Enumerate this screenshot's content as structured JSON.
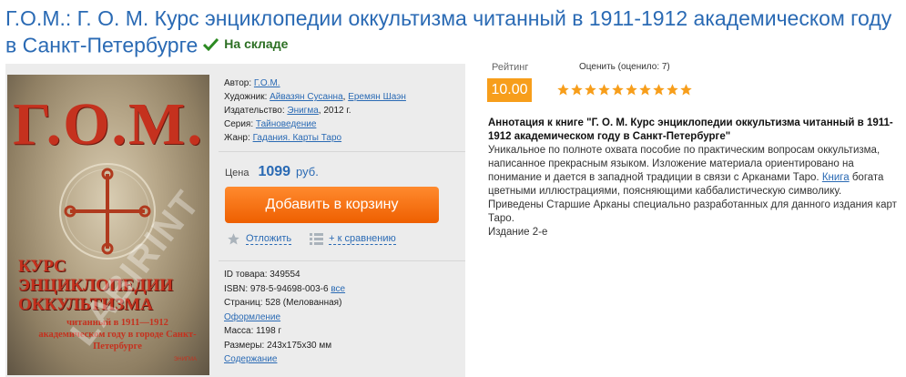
{
  "title": "Г.О.М.: Г. О. М. Курс энциклопедии оккультизма читанный в 1911-1912 академическом году в Санкт-Петербурге",
  "stock": {
    "label": "На складе",
    "color": "#2c6f23"
  },
  "cover": {
    "big": "Г.О.М.",
    "title": "КУРС ЭНЦИКЛОПЕДИИ ОККУЛЬТИЗМА",
    "subtitle": "читанный в 1911—1912 академическом году в городе Санкт-Петербурге",
    "publisher": "ЭНИГМА",
    "watermark": "LABIRINT"
  },
  "meta": {
    "author_label": "Автор:",
    "author": "Г.О.М.",
    "artist_label": "Художник:",
    "artist1": "Айвазян Сусанна",
    "artist2": "Еремян Шаэн",
    "publisher_label": "Издательство:",
    "publisher": "Энигма",
    "year": ", 2012 г.",
    "series_label": "Серия:",
    "series": "Тайноведение",
    "genre_label": "Жанр:",
    "genre": "Гадания. Карты Таро"
  },
  "price": {
    "label": "Цена",
    "value": "1099",
    "currency": "руб."
  },
  "cart_button": "Добавить в корзину",
  "actions": {
    "defer": "Отложить",
    "compare": "+ к сравнению"
  },
  "specs": {
    "id": "ID товара: 349554",
    "isbn": "ISBN: 978-5-94698-003-6",
    "isbn_all": "все",
    "pages": "Страниц: 528 (Мелованная)",
    "design": "Оформление",
    "weight": "Масса: 1198 г",
    "size": "Размеры: 243x175x30 мм",
    "contents": "Содержание"
  },
  "rating": {
    "label": "Рейтинг",
    "value": "10.00",
    "rate_label": "Оценить (оценило: 7)",
    "stars": 10,
    "accent": "#f79e1b"
  },
  "annotation": {
    "heading": "Аннотация к книге \"Г. О. М. Курс энциклопедии оккультизма читанный в 1911-1912 академическом году в Санкт-Петербурге\"",
    "p1": "Уникальное по полноте охвата пособие по практическим вопросам оккультизма, написанное прекрасным языком. Изложение материала ориентировано на понимание и дается в западной традиции в связи с Арканами Таро.",
    "link": "Книга",
    "p2": "богата цветными иллюстрациями, поясняющими каббалистическую символику. Приведены Старшие Арканы специально разработанных для данного издания карт Таро.",
    "edition": "Издание 2-е"
  },
  "colors": {
    "link": "#2a6ab4",
    "button": "#f26b0f",
    "panel": "#ececec"
  }
}
